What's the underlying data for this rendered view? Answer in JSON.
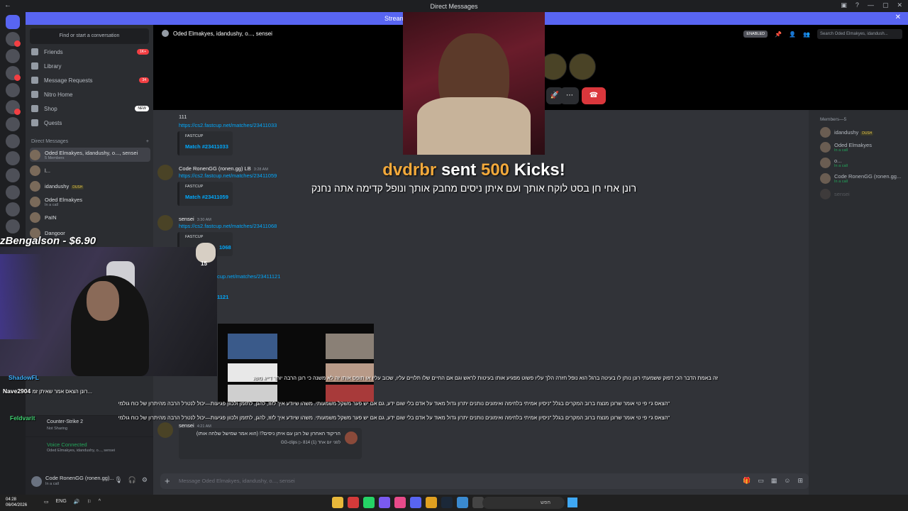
{
  "window": {
    "title": "Direct Messages"
  },
  "banner": {
    "text": "Streame"
  },
  "sidebar": {
    "search_placeholder": "Find or start a conversation",
    "nav": [
      {
        "label": "Friends",
        "badge": "1K+"
      },
      {
        "label": "Library",
        "badge": ""
      },
      {
        "label": "Message Requests",
        "badge": "34"
      },
      {
        "label": "Nitro Home",
        "badge": ""
      },
      {
        "label": "Shop",
        "badge": "NEW"
      },
      {
        "label": "Quests",
        "badge": ""
      }
    ],
    "dm_header": "Direct Messages",
    "dms": [
      {
        "name": "Oded Elmakyes, idandushy, o..., sensei",
        "sub": "5 Members"
      },
      {
        "name": "l...",
        "sub": ""
      },
      {
        "name": "idandushy",
        "sub": "",
        "tag": "DUSH"
      },
      {
        "name": "Oded Elmakyes",
        "sub": "In a call"
      },
      {
        "name": "PaIN",
        "sub": ""
      },
      {
        "name": "Dangoor",
        "sub": ""
      }
    ]
  },
  "activity": {
    "game": "Counter-Strike 2",
    "status": "Not Sharing"
  },
  "voice": {
    "status": "Voice Connected",
    "channel": "Oded Elmakyes, idandushy, o..., sensei"
  },
  "user": {
    "name": "Code RonenGG (ronen.gg)...",
    "status": "In a call"
  },
  "call": {
    "title": "Oded Elmakyes, idandushy, o..., sensei",
    "enabled_label": "ENABLED",
    "search_placeholder": "Search Oded Elmakyes, idandush..."
  },
  "messages": {
    "top_text": "111",
    "link1": "https://cs2.fastcup.net/matches/23411033",
    "embed_provider": "FASTCUP",
    "embed1": "Match #23411033",
    "author2": "Code RonenGG (ronen.gg) LB",
    "time2": "3:28 AM",
    "link2": "https://cs2.fastcup.net/matches/23411059",
    "embed2": "Match #23411059",
    "author3": "sensei",
    "time3": "3:30 AM",
    "link3": "https://cs2.fastcup.net/matches/23411068",
    "embed3_partial": "1068",
    "link4_partial": "cup.net/matches/23411121",
    "embed4_partial": "1121",
    "author5": "sensei",
    "time5": "4:21 AM"
  },
  "members": {
    "header": "Members—5",
    "list": [
      {
        "name": "idandushy",
        "sub": "",
        "tag": "DUSH"
      },
      {
        "name": "Oded Elmakyes",
        "sub": "In a call"
      },
      {
        "name": "o...",
        "sub": "In a call"
      },
      {
        "name": "Code RonenGG (ronen.gg...",
        "sub": "In a call"
      },
      {
        "name": "sensei",
        "sub": ""
      }
    ]
  },
  "composer": {
    "placeholder": "Message Oded Elmakyes, idandushy, o..., sensei"
  },
  "alert": {
    "donor": "dvdrbr",
    "sent": "sent",
    "amount": "500",
    "unit": "Kicks!",
    "message": "רונן אחי חן בסט לוקח אותך ועם איתן ניסים מחבק אותך ונופל קדימה אתה נחנק"
  },
  "donation_overlay": {
    "text": "zBengalson - $6.90"
  },
  "emote": {
    "count": "15"
  },
  "stream_chat": {
    "lines": [
      {
        "user": "ShadowFL",
        "text": ""
      },
      {
        "user": "Nave2904",
        "text": "רונן הצאס אמר שאיתן זמ..."
      },
      {
        "user": "Feldvarit",
        "text": ""
      }
    ],
    "rtl1": "זה באמת הדבר הכי דפוק ששמעתי רונן נותן לו בעיטה ברגל הוא נופל חזרה הלך עליו פשוט מפגיע אותו בעיטות לראש וגם אם החיים שלו תלויים עליו, שכוב עליו או תופס אותו זה לא משנה כי רונן הרבה יותר דייג משנ",
    "rtl2": "\"הצאס ג'י פי טי אומר שרונן מנצח ברוב המקרים בגלל \"ניסיון אמיתי בלחימה ואימונים נותנים יתרון גדול מאוד על אדם בלי שום ידע, גם אם יש פער משקל משמעותי. משהו שיודע איך לזוז, להגן, לתזמן ולכוון פגיעות—יכול לנטרל הרבה מהיתרון של כוח גולמי",
    "rtl3": "\"הצאס ג'י פי טי אומר שרונן מנצח ברוב המקרים בגלל \"ניסיון אמיתי בלחימה ואימונים נותנים יתרון גדול מאוד על אדם בלי שום ידע, גם אם יש פער משקל משמעותי. משהו שיודע איך לזוז, להגן, לתזמן ולכוון פגיעות—יכול לנטרל הרבה מהיתרון של כוח גולמי"
  },
  "clip": {
    "title": "הריקוד האחרון של רונן עם איתן ניסים?! (הוא אמר שמישל שלחה אותו)",
    "meta": "לפני יום אחד (1) 814 ▷ GG-clips"
  },
  "taskbar": {
    "time": "04:28",
    "date": "06/04/2026",
    "lang": "ENG",
    "search": "חפש"
  },
  "colors": {
    "blurple": "#5865f2",
    "green": "#23a55a",
    "red": "#f23f43",
    "gold": "#f2a93b"
  }
}
